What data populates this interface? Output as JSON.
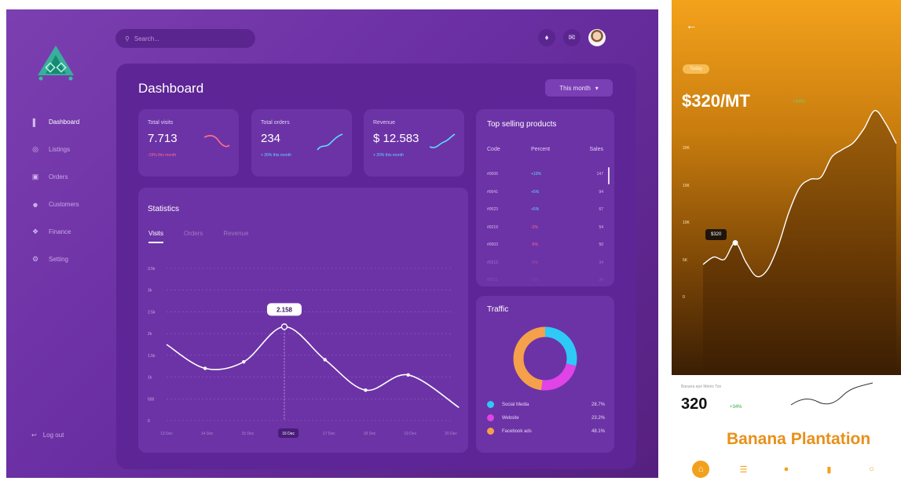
{
  "dashboard": {
    "search": {
      "placeholder": "Search..."
    },
    "sidebar": {
      "items": [
        {
          "label": "Dashboard",
          "icon": "bar-chart-icon"
        },
        {
          "label": "Listings",
          "icon": "list-icon"
        },
        {
          "label": "Orders",
          "icon": "cart-icon"
        },
        {
          "label": "Customers",
          "icon": "user-icon"
        },
        {
          "label": "Finance",
          "icon": "finance-icon"
        },
        {
          "label": "Setting",
          "icon": "gear-icon"
        }
      ],
      "logout": "Log out"
    },
    "header": {
      "title": "Dashboard",
      "period": "This month"
    },
    "cards": [
      {
        "label": "Total visits",
        "value": "7.713",
        "change": "-15% this month",
        "trend": "down"
      },
      {
        "label": "Total orders",
        "value": "234",
        "change": "+ 30% this month",
        "trend": "up"
      },
      {
        "label": "Revenue",
        "value": "$ 12.583",
        "change": "+ 20% this month",
        "trend": "up"
      }
    ],
    "statistics": {
      "title": "Statistics",
      "tabs": [
        "Visits",
        "Orders",
        "Revenue"
      ],
      "active_tab": "Visits",
      "tooltip": "2.158"
    },
    "top_selling": {
      "title": "Top selling products",
      "columns": [
        "Code",
        "Percent",
        "Sales"
      ],
      "rows": [
        {
          "code": "#0006",
          "percent": "+10%",
          "sales": "147"
        },
        {
          "code": "#0041",
          "percent": "+5%",
          "sales": "94"
        },
        {
          "code": "#0023",
          "percent": "+5%",
          "sales": "67"
        },
        {
          "code": "#0219",
          "percent": "-2%",
          "sales": "54"
        },
        {
          "code": "#0003",
          "percent": "-5%",
          "sales": "50"
        },
        {
          "code": "#0213",
          "percent": "-5%",
          "sales": "34"
        },
        {
          "code": "#0311",
          "percent": "-5%",
          "sales": "34"
        }
      ]
    },
    "traffic": {
      "title": "Traffic",
      "items": [
        {
          "label": "Social Media",
          "percent": "28.7%",
          "color": "#2ec9f7",
          "value": 28.7
        },
        {
          "label": "Website",
          "percent": "23.2%",
          "color": "#e043e6",
          "value": 23.2
        },
        {
          "label": "Facebook ads",
          "percent": "48.1%",
          "color": "#f5a04a",
          "value": 48.1
        }
      ]
    },
    "colors": {
      "accent": "#ffffff",
      "up": "#5ed9ff",
      "down": "#ff6b8a"
    }
  },
  "chart_data": [
    {
      "type": "line",
      "categories": [
        "13 Dec",
        "14 Dec",
        "15 Dec",
        "16 Dec",
        "17 Dec",
        "18 Dec",
        "19 Dec",
        "20 Dec"
      ],
      "y_ticks": [
        "0",
        "500",
        "1k",
        "1.5k",
        "2k",
        "2.5k",
        "3k",
        "3.5k"
      ],
      "x": [
        0,
        0.95,
        1.9,
        2.9,
        3.9,
        4.9,
        5.95,
        7.2
      ],
      "y": [
        1750,
        1200,
        1350,
        2158,
        1400,
        700,
        1050,
        300
      ],
      "ylim": [
        0,
        3500
      ],
      "grid": true
    },
    {
      "type": "pie",
      "labels": [
        "Social Media",
        "Website",
        "Facebook ads"
      ],
      "values": [
        28.7,
        23.2,
        48.1
      ]
    },
    {
      "type": "line",
      "y_ticks": [
        "0",
        "5K",
        "10K",
        "15K",
        "20K"
      ],
      "values": [
        4300,
        5300,
        5000,
        7200,
        4600,
        2700,
        3600,
        6800,
        11300,
        14600,
        15700,
        16000,
        18700,
        19700,
        20600,
        22500,
        24900,
        23200,
        20500
      ],
      "ylim": [
        0,
        25000
      ],
      "highlight": {
        "label": "$320"
      }
    }
  ],
  "mobile": {
    "today": "Today",
    "price": "$320/MT",
    "price_change": "+34%",
    "bottom_label": "Banana epe Metric Ton",
    "bottom_value": "320",
    "bottom_change": "+34%",
    "brand": "Banana Plantation",
    "nav": [
      "home-icon",
      "list-icon",
      "mic-icon",
      "book-icon",
      "lock-icon"
    ],
    "colors": {
      "primary": "#f2a11c",
      "up": "#2faa3a"
    }
  }
}
